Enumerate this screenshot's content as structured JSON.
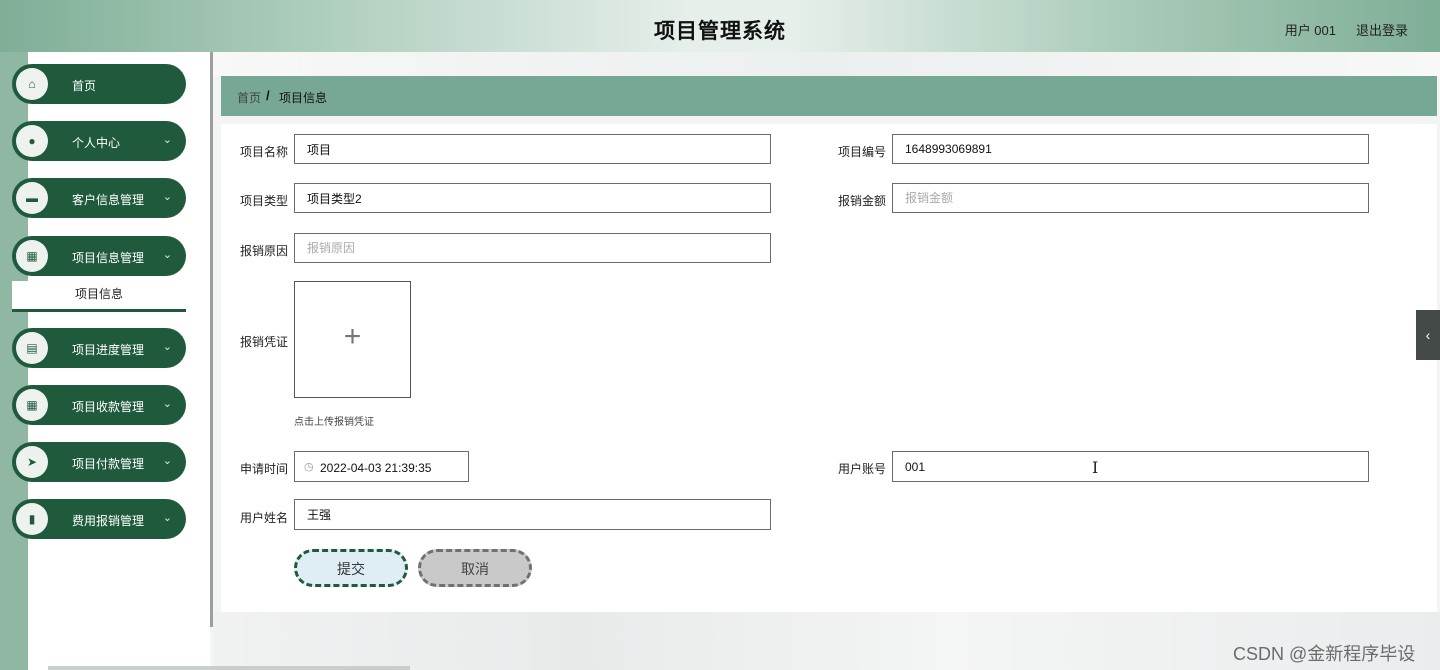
{
  "header": {
    "title": "项目管理系统",
    "user": "用户 001",
    "logout": "退出登录"
  },
  "sidebar": {
    "items": [
      {
        "label": "首页",
        "icon": "home-icon",
        "glyph": "⌂",
        "has_chevron": false
      },
      {
        "label": "个人中心",
        "icon": "user-icon",
        "glyph": "●",
        "has_chevron": true
      },
      {
        "label": "客户信息管理",
        "icon": "monitor-icon",
        "glyph": "▬",
        "has_chevron": true
      },
      {
        "label": "项目信息管理",
        "icon": "grid-icon",
        "glyph": "▦",
        "has_chevron": true
      },
      {
        "label": "项目进度管理",
        "icon": "chart-icon",
        "glyph": "▤",
        "has_chevron": true
      },
      {
        "label": "项目收款管理",
        "icon": "grid-icon",
        "glyph": "▦",
        "has_chevron": true
      },
      {
        "label": "项目付款管理",
        "icon": "send-icon",
        "glyph": "➤",
        "has_chevron": true
      },
      {
        "label": "费用报销管理",
        "icon": "bar-chart-icon",
        "glyph": "▮",
        "has_chevron": true
      }
    ],
    "submenu_label": "项目信息",
    "chevron": "⌄"
  },
  "breadcrumb": {
    "home": "首页",
    "separator": "/",
    "current": "项目信息"
  },
  "form": {
    "project_name_label": "项目名称",
    "project_name_value": "项目",
    "project_no_label": "项目编号",
    "project_no_value": "1648993069891",
    "project_type_label": "项目类型",
    "project_type_value": "项目类型2",
    "reimburse_amount_label": "报销金额",
    "reimburse_amount_placeholder": "报销金额",
    "reimburse_reason_label": "报销原因",
    "reimburse_reason_placeholder": "报销原因",
    "voucher_label": "报销凭证",
    "voucher_plus": "+",
    "voucher_hint": "点击上传报销凭证",
    "apply_time_label": "申请时间",
    "apply_time_value": "2022-04-03 21:39:35",
    "clock_glyph": "◷",
    "user_account_label": "用户账号",
    "user_account_value": "001",
    "user_name_label": "用户姓名",
    "user_name_value": "王强",
    "submit_label": "提交",
    "cancel_label": "取消"
  },
  "side_tab_glyph": "‹",
  "cursor_glyph": "I",
  "watermark": "CSDN @金新程序毕设",
  "colors": {
    "primary": "#1f5a3d",
    "breadcrumb_bg": "#76a893",
    "rail": "#8fb7a3"
  }
}
